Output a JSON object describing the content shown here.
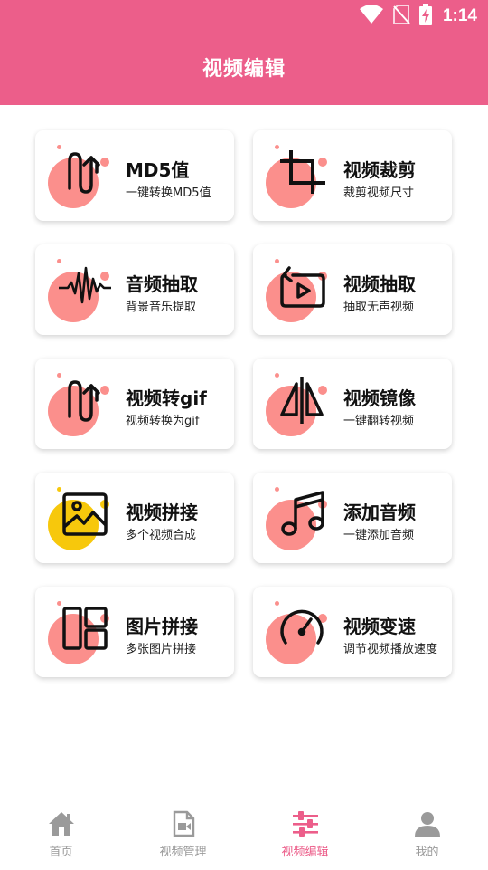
{
  "status_bar": {
    "time": "1:14"
  },
  "header": {
    "title": "视频编辑"
  },
  "tools": [
    {
      "title": "MD5值",
      "subtitle": "一键转换MD5值",
      "icon": "md5-hash-icon",
      "accent": "#fb8f8c"
    },
    {
      "title": "视频裁剪",
      "subtitle": "裁剪视频尺寸",
      "icon": "crop-icon",
      "accent": "#fb8f8c"
    },
    {
      "title": "音频抽取",
      "subtitle": "背景音乐提取",
      "icon": "waveform-icon",
      "accent": "#fb8f8c"
    },
    {
      "title": "视频抽取",
      "subtitle": "抽取无声视频",
      "icon": "video-replay-icon",
      "accent": "#fb8f8c"
    },
    {
      "title": "视频转gif",
      "subtitle": "视频转换为gif",
      "icon": "gif-convert-icon",
      "accent": "#fb8f8c"
    },
    {
      "title": "视频镜像",
      "subtitle": "一键翻转视频",
      "icon": "flip-mirror-icon",
      "accent": "#fb8f8c"
    },
    {
      "title": "视频拼接",
      "subtitle": "多个视频合成",
      "icon": "image-frame-icon",
      "accent": "#f7c80c"
    },
    {
      "title": "添加音频",
      "subtitle": "一键添加音频",
      "icon": "music-note-icon",
      "accent": "#fb8f8c"
    },
    {
      "title": "图片拼接",
      "subtitle": "多张图片拼接",
      "icon": "collage-layout-icon",
      "accent": "#fb8f8c"
    },
    {
      "title": "视频变速",
      "subtitle": "调节视频播放速度",
      "icon": "speedometer-icon",
      "accent": "#fb8f8c"
    }
  ],
  "tabbar": {
    "items": [
      {
        "label": "首页",
        "icon": "home-icon",
        "active": false
      },
      {
        "label": "视频管理",
        "icon": "video-file-icon",
        "active": false
      },
      {
        "label": "视频编辑",
        "icon": "sliders-icon",
        "active": true
      },
      {
        "label": "我的",
        "icon": "user-icon",
        "active": false
      }
    ],
    "active_color": "#ec5e8a",
    "inactive_color": "#9a9a9a"
  },
  "colors": {
    "brand": "#ec5e8a",
    "accent_pink": "#fb8f8c",
    "accent_yellow": "#f7c80c"
  }
}
